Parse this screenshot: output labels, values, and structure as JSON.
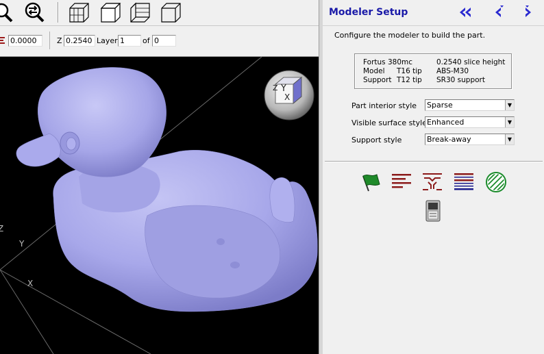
{
  "slicebar": {
    "offset_value": "0.0000",
    "z_label": "Z",
    "z_value": "0.2540",
    "layer_label": "Layer",
    "layer_value": "1",
    "of_label": "of",
    "of_value": "0"
  },
  "viewport": {
    "axis_labels": {
      "x": "X",
      "y": "Y",
      "z": "Z"
    },
    "nav_cube": {
      "y": "Y",
      "z": "Z",
      "x": "X"
    }
  },
  "panel": {
    "title": "Modeler Setup",
    "description": "Configure the modeler to build the part.",
    "info": {
      "modeler": "Fortus 380mc",
      "slice_height": "0.2540 slice height",
      "model_label": "Model",
      "model_tip": "T16 tip",
      "model_material": "ABS-M30",
      "support_label": "Support",
      "support_tip": "T12 tip",
      "support_material": "SR30 support"
    },
    "fields": {
      "interior_label": "Part interior style",
      "interior_value": "Sparse",
      "surface_label": "Visible surface style",
      "surface_value": "Enhanced",
      "support_label": "Support style",
      "support_value": "Break-away"
    }
  },
  "colors": {
    "title_blue": "#1a1aa8",
    "part_color": "#a8a8ec",
    "tool_red": "#8b1a1a",
    "tool_blue": "#1a1a8b",
    "tool_green": "#1a8b2a"
  }
}
